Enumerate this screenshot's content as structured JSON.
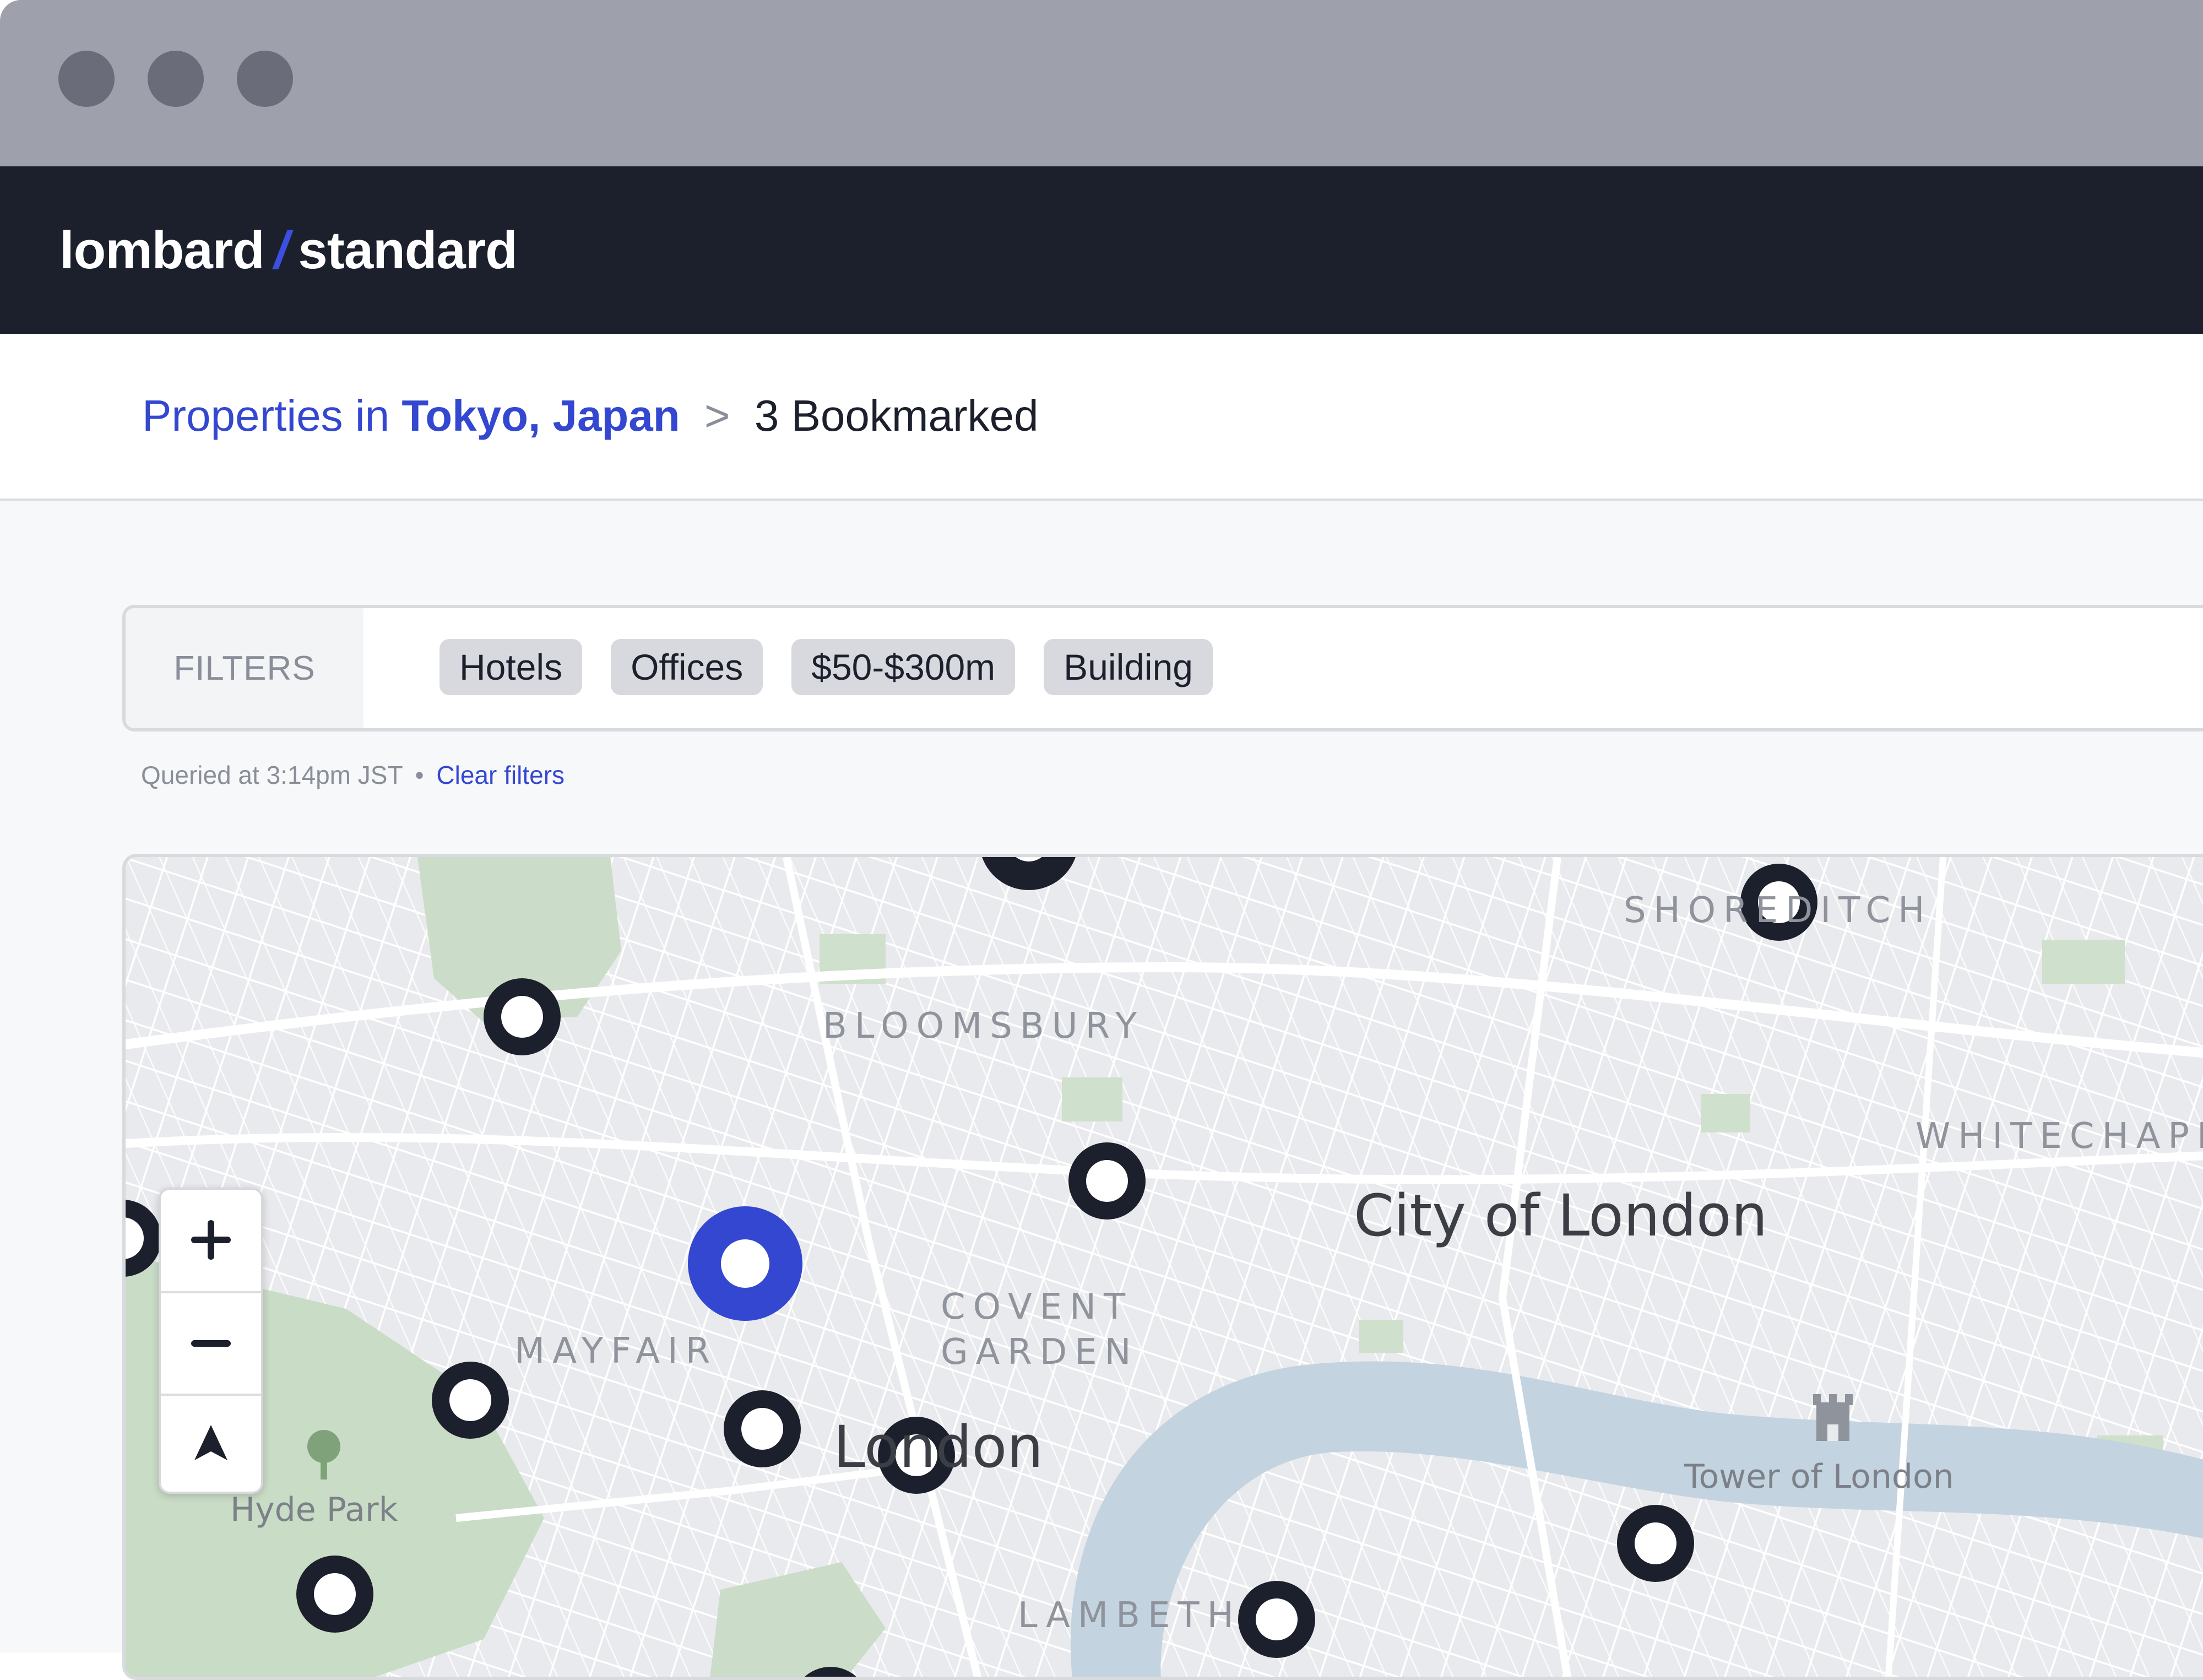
{
  "window": {
    "controls": [
      "close",
      "minimize",
      "maximize"
    ]
  },
  "brand": {
    "name_left": "lombard",
    "separator": "/",
    "name_right": "standard",
    "accent_color": "#3c4fe0",
    "bar_color": "#1c202c"
  },
  "breadcrumb": {
    "prefix": "Properties in",
    "city": "Tokyo, Japan",
    "separator": ">",
    "current": "3 Bookmarked"
  },
  "filters": {
    "label": "FILTERS",
    "chips": [
      "Hotels",
      "Offices",
      "$50-$300m",
      "Building"
    ],
    "query_time": "Queried at 3:14pm JST",
    "dot": "•",
    "clear_label": "Clear filters"
  },
  "map": {
    "district_labels": {
      "bloomsbury": "BLOOMSBURY",
      "shoreditch": "SHOREDITCH",
      "whitechapel": "WHITECHAPEL",
      "covent_garden_1": "COVENT",
      "covent_garden_2": "GARDEN",
      "mayfair": "MAYFAIR",
      "lambeth": "LAMBETH"
    },
    "city_labels": {
      "city_of_london": "City of London",
      "london": "London"
    },
    "poi_labels": {
      "hyde_park": "Hyde Park",
      "tower_of_london": "Tower of London"
    },
    "marker_count": 14,
    "selected_marker_color": "#3447d1",
    "marker_color": "#1c202c",
    "controls": {
      "zoom_in": "zoom-in",
      "zoom_out": "zoom-out",
      "locate": "locate"
    }
  }
}
